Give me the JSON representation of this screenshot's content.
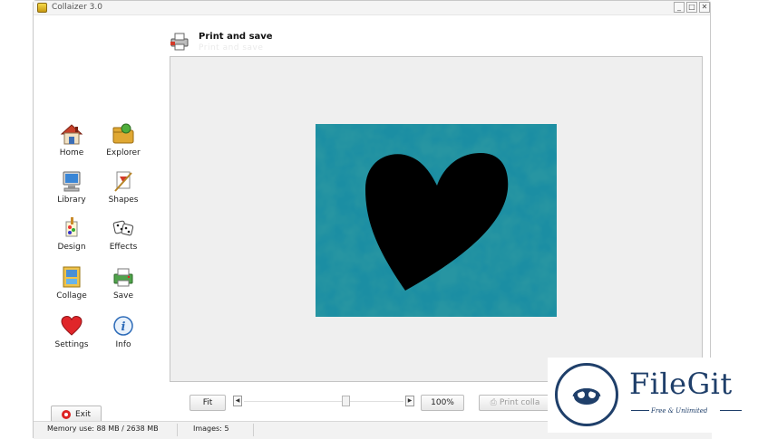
{
  "window": {
    "title": "Collaizer 3.0",
    "controls": {
      "minimize": "_",
      "maximize": "□",
      "close": "✕"
    }
  },
  "sidebar": {
    "items": [
      {
        "id": "home",
        "label": "Home",
        "icon": "house-icon"
      },
      {
        "id": "explorer",
        "label": "Explorer",
        "icon": "folder-explorer-icon"
      },
      {
        "id": "library",
        "label": "Library",
        "icon": "monitor-library-icon"
      },
      {
        "id": "shapes",
        "label": "Shapes",
        "icon": "shapes-icon"
      },
      {
        "id": "design",
        "label": "Design",
        "icon": "paint-brush-icon"
      },
      {
        "id": "effects",
        "label": "Effects",
        "icon": "dice-icon"
      },
      {
        "id": "collage",
        "label": "Collage",
        "icon": "collage-icon"
      },
      {
        "id": "save",
        "label": "Save",
        "icon": "save-printer-icon"
      },
      {
        "id": "settings",
        "label": "Settings",
        "icon": "heart-icon"
      },
      {
        "id": "info",
        "label": "Info",
        "icon": "info-icon"
      }
    ],
    "exit_label": "Exit"
  },
  "header": {
    "title": "Print and save",
    "subtitle": "Print and save"
  },
  "preview": {
    "background_color": "#1b8ea3",
    "shape": "heart",
    "shape_color": "#000000"
  },
  "toolbar": {
    "fit_label": "Fit",
    "scroll_left": "◀",
    "scroll_right": "▶",
    "zoom_label": "100%",
    "print_label": "Print colla"
  },
  "status": {
    "memory": "Memory use: 88 MB / 2638 MB",
    "images": "Images: 5"
  },
  "watermark": {
    "brand": "FileGit",
    "tagline": "Free & Unlimited"
  }
}
